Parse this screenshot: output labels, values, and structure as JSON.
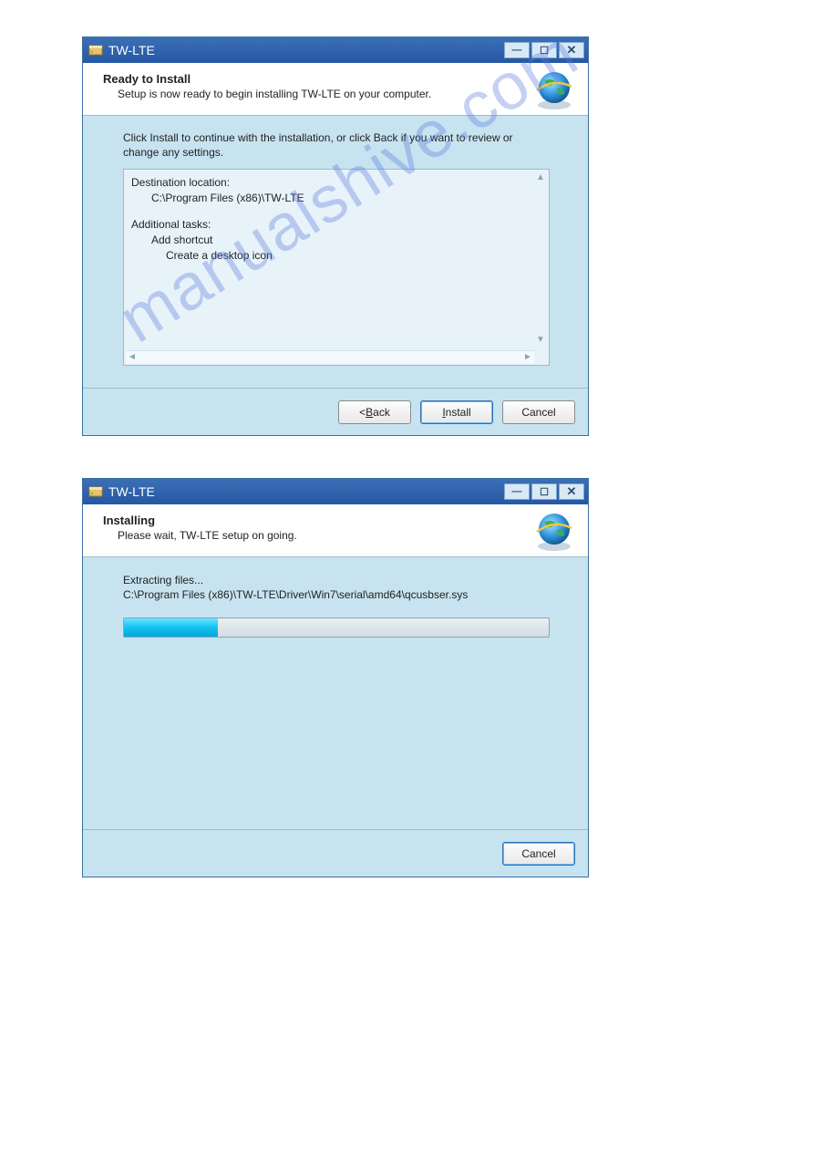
{
  "watermark": "manualshive.com",
  "window1": {
    "title": "TW-LTE",
    "header_title": "Ready to Install",
    "header_subtitle": "Setup is now ready to begin installing TW-LTE on your computer.",
    "instruction": "Click Install to continue with the installation, or click Back if you want to review or change any settings.",
    "summary": {
      "dest_label": "Destination location:",
      "dest_path": "C:\\Program Files (x86)\\TW-LTE",
      "tasks_label": "Additional tasks:",
      "task1": "Add shortcut",
      "task2": "Create a desktop icon"
    },
    "buttons": {
      "back": "< Back",
      "install": "Install",
      "cancel": "Cancel"
    }
  },
  "window2": {
    "title": "TW-LTE",
    "header_title": "Installing",
    "header_subtitle": "Please wait, TW-LTE setup on going.",
    "extracting_label": "Extracting files...",
    "extracting_path": "C:\\Program Files (x86)\\TW-LTE\\Driver\\Win7\\serial\\amd64\\qcusbser.sys",
    "progress_percent": 22,
    "buttons": {
      "cancel": "Cancel"
    }
  }
}
